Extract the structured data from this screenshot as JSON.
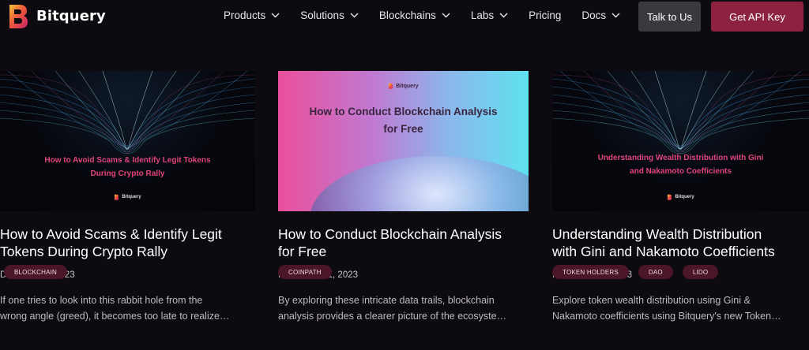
{
  "header": {
    "brand": "Bitquery",
    "nav": [
      {
        "label": "Products",
        "has_dropdown": true
      },
      {
        "label": "Solutions",
        "has_dropdown": true
      },
      {
        "label": "Blockchains",
        "has_dropdown": true
      },
      {
        "label": "Labs",
        "has_dropdown": true
      },
      {
        "label": "Pricing",
        "has_dropdown": false
      },
      {
        "label": "Docs",
        "has_dropdown": true
      }
    ],
    "talk_button": "Talk to Us",
    "api_button": "Get API Key"
  },
  "colors": {
    "background": "#0d0b10",
    "accent": "#8c2240",
    "tag_bg": "#4a1628",
    "thumb_title_pink": "#e0447a"
  },
  "cards": [
    {
      "thumb_style": "dark-waves",
      "thumb_title_lines": [
        "How to Avoid Scams & Identify Legit Tokens",
        "During Crypto Rally"
      ],
      "thumb_brand": "Bitquery",
      "title_lines": [
        "How to Avoid Scams & Identify Legit",
        "Tokens During Crypto Rally"
      ],
      "date": "December 4, 2023",
      "excerpt_lines": [
        "If one tries to look into this rabbit hole from the",
        "wrong angle (greed), it becomes too late to realize…"
      ],
      "tags": [
        "BLOCKCHAIN"
      ]
    },
    {
      "thumb_style": "bright-gradient",
      "thumb_title_lines": [
        "How to Conduct Blockchain Analysis",
        "for Free"
      ],
      "thumb_brand": "Bitquery",
      "title_lines": [
        "How to Conduct Blockchain Analysis",
        "for Free"
      ],
      "date": "November 21, 2023",
      "excerpt_lines": [
        "By exploring these intricate data trails, blockchain",
        "analysis provides a clearer picture of the ecosyste…"
      ],
      "tags": [
        "COINPATH"
      ]
    },
    {
      "thumb_style": "dark-waves",
      "thumb_title_lines": [
        "Understanding Wealth Distribution with Gini",
        "and Nakamoto Coefficients"
      ],
      "thumb_brand": "Bitquery",
      "title_lines": [
        "Understanding Wealth Distribution",
        "with Gini and Nakamoto Coefficients"
      ],
      "date": "November 16, 2023",
      "excerpt_lines": [
        "Explore token wealth distribution using Gini &",
        "Nakamoto coefficients using Bitquery's new Token…"
      ],
      "tags": [
        "TOKEN HOLDERS",
        "DAO",
        "LIDO"
      ]
    }
  ]
}
